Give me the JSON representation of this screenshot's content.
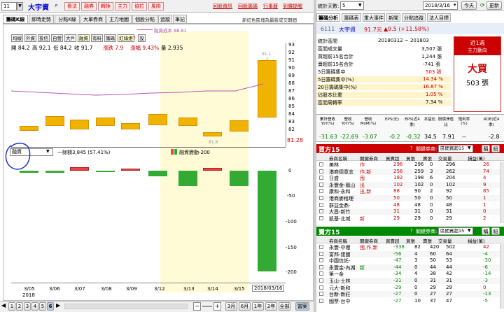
{
  "top": {
    "code_value": "11",
    "stock_name": "大宇資",
    "actions": [
      "看法",
      "融券",
      "轉換",
      "主力",
      "協拉",
      "風險"
    ],
    "links": [
      "回股資訊",
      "回股籌碼",
      "行事曆",
      "到價提醒"
    ]
  },
  "left_tabs": [
    "籌碼K線",
    "即時走勢",
    "分點K線",
    "大單券商",
    "主力地圖",
    "個股分點",
    "追蹤",
    "筆記"
  ],
  "left_note": "新紅色區塊為最新成交期間",
  "tool_tabs": [
    "均線",
    "外資",
    "投信",
    "自營",
    "大戶",
    "融資",
    "有料",
    "籌碼",
    "紅綠燈"
  ],
  "tool_extra": "設",
  "cost_label": "融資成本 88.81",
  "ohlc": {
    "open": "開 84.2",
    "high": "高 92.1",
    "low": "低 84.2",
    "close": "收 91.7",
    "change": "漲跌 7.9",
    "pct": "漲幅 9.43%",
    "vol": "量 2,935"
  },
  "price_axis": [
    "93",
    "92",
    "91",
    "90",
    "89",
    "88",
    "87",
    "86",
    "85",
    "84",
    "83",
    "82",
    "81"
  ],
  "current_price": "81.28",
  "hi_mark": "91.1",
  "lo_mark": "81.8",
  "lower_select": "融資",
  "lower_info": "一餘額3,845 (57.41%)",
  "lower_legend": "融資變動-200",
  "lower_axis": [
    "0",
    "-50",
    "-100",
    "-150",
    "-200"
  ],
  "dates": [
    "3/05",
    "3/06",
    "3/07",
    "3/08",
    "3/09",
    "3/12",
    "3/13",
    "3/14",
    "3/15",
    "2018/03/16"
  ],
  "year": "2018",
  "pages": [
    "1",
    "2",
    "3",
    "4",
    "5",
    "6"
  ],
  "bottom_tabs": [
    "3月",
    "6月",
    "1年",
    "2年",
    "全部",
    "當案"
  ],
  "right": {
    "days_label": "統計天數:",
    "days_value": "5",
    "date_value": "2018/3/16",
    "today_btn": "今天",
    "refresh_btn": "更新",
    "tabs": [
      "籌碼分析",
      "籌碼表",
      "重大事件",
      "新聞",
      "分點追蹤",
      "法人目標"
    ],
    "code": "6111",
    "name": "大宇資",
    "price": "91.7元",
    "change": "▲9.5 (+11.58%)",
    "stats": [
      {
        "label": "統計區間",
        "value": "20180312 ~ 201803"
      },
      {
        "label": "區間成交量",
        "value": "3,507 張"
      },
      {
        "label": "買超前15名合計",
        "value": "1,244 張"
      },
      {
        "label": "賣超前15名合計",
        "value": "-741 張"
      },
      {
        "label": "5日籌碼集中",
        "value": "503 張"
      },
      {
        "label": "5日籌碼集中(%)",
        "value": "14.34 %"
      },
      {
        "label": "20日籌碼集中(%)",
        "value": "16.87 %"
      },
      {
        "label": "佔股本比重",
        "value": "1.05 %"
      },
      {
        "label": "區間周轉率",
        "value": "7.34 %"
      }
    ],
    "motion_title": "近1週",
    "motion_sub": "主力動向",
    "verdict": "大買",
    "verdict_qty": "503 張",
    "fin_headers": [
      "累計營收YoY(%)",
      "營收YoY(%)",
      "營收MoM(%)",
      "EPS(元)",
      "EPS(近4季)",
      "本益比",
      "股價淨值比",
      "殖利率(%)",
      "ROE(近4季)"
    ],
    "fin_values": [
      "-31.63",
      "-22.69",
      "-3.07",
      "-0.2",
      "-0.32",
      "34.5",
      "7.91",
      "--",
      "-2.8"
    ],
    "buy_title": "買方15",
    "sell_title": "賣方15",
    "rel_label": "關鍵券商:",
    "rel_value": "區間買超15",
    "btn_a": "稱",
    "btn_b": "紐",
    "col_headers": [
      "券商名稱",
      "關鍵券商",
      "買賣超",
      "買張",
      "賣張",
      "交易量",
      "損益(萬)"
    ],
    "buy_rows": [
      [
        "美林",
        "作",
        "296",
        "296",
        "0",
        "296",
        "26"
      ],
      [
        "港商德意志",
        "作,新",
        "256",
        "259",
        "3",
        "262",
        "74"
      ],
      [
        "日盛",
        "囤",
        "192",
        "198",
        "6",
        "204",
        "4"
      ],
      [
        "永豐金-鳳山",
        "出",
        "102",
        "102",
        "0",
        "102",
        "9"
      ],
      [
        "康和-永和",
        "出,新",
        "88",
        "90",
        "2",
        "92",
        "85"
      ],
      [
        "港商麥格理",
        "",
        "50",
        "50",
        "0",
        "50",
        "1"
      ],
      [
        "群益金鼎-",
        "",
        "48",
        "48",
        "0",
        "48",
        "1"
      ],
      [
        "大昌-新竹",
        "",
        "31",
        "31",
        "0",
        "31",
        "0"
      ],
      [
        "凱基-北城",
        "新",
        "29",
        "29",
        "0",
        "29",
        "2"
      ]
    ],
    "sell_rows": [
      [
        "永豐-中壢",
        "囤,作,新",
        "-338",
        "82",
        "420",
        "502",
        "42"
      ],
      [
        "富邦-建國",
        "",
        "-56",
        "4",
        "60",
        "64",
        "-4"
      ],
      [
        "中國信託-",
        "",
        "-47",
        "3",
        "50",
        "53",
        "-30"
      ],
      [
        "永豐金-內湖",
        "斷",
        "-44",
        "0",
        "44",
        "44",
        "-6"
      ],
      [
        "第一金",
        "",
        "-34",
        "4",
        "38",
        "42",
        "-14"
      ],
      [
        "玉山-士林",
        "",
        "-31",
        "0",
        "31",
        "31",
        "-3"
      ],
      [
        "元大-新和",
        "",
        "-29",
        "0",
        "29",
        "29",
        "0"
      ],
      [
        "台新-新莊",
        "",
        "-27",
        "0",
        "27",
        "27",
        "-13"
      ],
      [
        "國票-台中",
        "",
        "-27",
        "10",
        "37",
        "47",
        "-5"
      ]
    ]
  }
}
